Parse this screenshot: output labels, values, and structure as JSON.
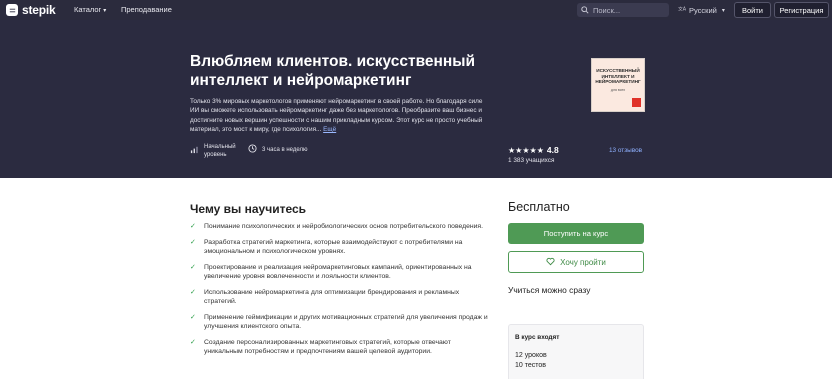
{
  "nav": {
    "logo_text": "stepik",
    "catalog": "Каталог",
    "teaching": "Преподавание",
    "search_placeholder": "Поиск...",
    "language": "Русский",
    "login": "Войти",
    "register": "Регистрация"
  },
  "hero": {
    "title": "Влюбляем клиентов. искусственный интеллект и нейромаркетинг",
    "description": "Только 3% мировых маркетологов применяют нейромаркетинг в своей работе. Но благодаря силе ИИ вы сможете использовать нейромаркетинг даже без маркетологов. Преобразите ваш бизнес и достигните новых вершин успешности с нашим прикладным курсом. Этот курс не просто учебный материал, это мост к миру, где психология...",
    "more_link": "Ещё",
    "level_line1": "Начальный",
    "level_line2": "уровень",
    "time": "3 часа в неделю",
    "cover": {
      "title": "ИСКУССТВЕННЫЙ ИНТЕЛЛЕКТ И НЕЙРОМАРКЕТИНГ",
      "subtitle": "для всех"
    },
    "rating_stars": "★★★★★",
    "rating": "4.8",
    "learners": "1 383 учащихся",
    "reviews": "13 отзывов"
  },
  "learn": {
    "title": "Чему вы научитесь",
    "items": [
      "Понимание психологических и нейробиологических основ потребительского поведения.",
      "Разработка стратегий маркетинга, которые взаимодействуют с потребителями на эмоциональном и психологическом уровнях.",
      "Проектирование и реализация нейромаркетинговых кампаний, ориентированных на увеличение уровня вовлеченности и лояльности клиентов.",
      "Использование нейромаркетинга для оптимизации брендирования и рекламных стратегий.",
      "Применение геймификации и других мотивационных стратегий для увеличения продаж и улучшения клиентского опыта.",
      "Создание персонализированных маркетинговых стратегий, которые отвечают уникальным потребностям и предпочтениям вашей целевой аудитории."
    ]
  },
  "sidebar": {
    "price": "Бесплатно",
    "enroll": "Поступить на курс",
    "wishlist": "Хочу пройти",
    "easy": "Учиться можно сразу",
    "includes_title": "В курс входят",
    "lessons": "12 уроков",
    "tests": "10 тестов"
  },
  "colors": {
    "header_bg": "#2b2b40",
    "accent_green": "#4f9a55",
    "link_blue": "#8fb1ff"
  }
}
